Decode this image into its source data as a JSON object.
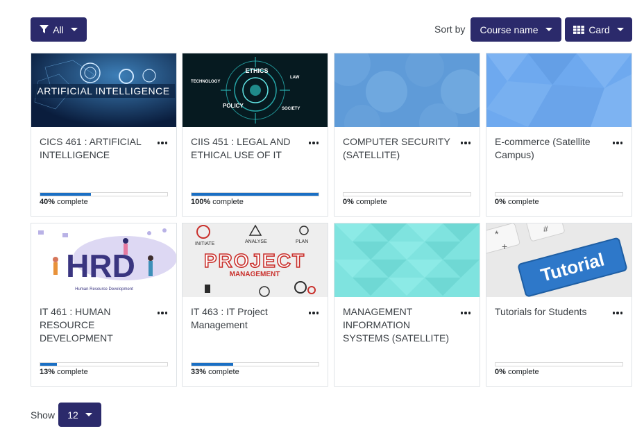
{
  "toolbar": {
    "filter_label": "All",
    "sort_label": "Sort by",
    "sort_value": "Course name",
    "view_label": "Card"
  },
  "courses": [
    {
      "title": "CICS 461 : ARTIFICIAL INTELLIGENCE",
      "image_text": "ARTIFICIAL INTELLIGENCE",
      "progress": 40,
      "pct_num": "40%",
      "pct_suffix": "complete"
    },
    {
      "title": "CIIS 451 : LEGAL AND ETHICAL USE OF IT",
      "image_words": [
        "ETHICS",
        "TECHNOLOGY",
        "LAW",
        "POLICY",
        "SOCIETY"
      ],
      "progress": 100,
      "pct_num": "100%",
      "pct_suffix": "complete"
    },
    {
      "title": "COMPUTER SECURITY (SATELLITE)",
      "progress": 0,
      "pct_num": "0%",
      "pct_suffix": "complete"
    },
    {
      "title": "E-commerce (Satellite Campus)",
      "progress": 0,
      "pct_num": "0%",
      "pct_suffix": "complete"
    },
    {
      "title": "IT 461 : HUMAN RESOURCE DEVELOPMENT",
      "image_text": "HRD",
      "image_subtext": "Human Resource Development",
      "progress": 13,
      "pct_num": "13%",
      "pct_suffix": "complete"
    },
    {
      "title": "IT 463 : IT Project Management",
      "image_text": "PROJECT",
      "image_subtext": "MANAGEMENT",
      "image_words": [
        "INITIATE",
        "ANALYSE",
        "PLAN"
      ],
      "progress": 33,
      "pct_num": "33%",
      "pct_suffix": "complete"
    },
    {
      "title": "MANAGEMENT INFORMATION SYSTEMS (SATELLITE)"
    },
    {
      "title": "Tutorials for Students",
      "image_text": "Tutorial",
      "progress": 0,
      "pct_num": "0%",
      "pct_suffix": "complete"
    }
  ],
  "footer": {
    "show_label": "Show",
    "show_value": "12"
  },
  "colors": {
    "button_bg": "#2b2a6b",
    "progress_fill": "#1a6fc4"
  }
}
